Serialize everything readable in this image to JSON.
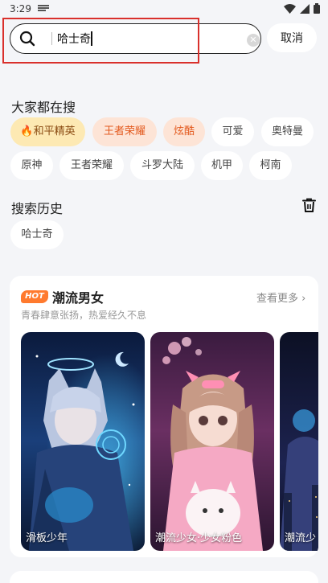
{
  "status_bar": {
    "time": "3:29"
  },
  "search": {
    "value": "哈士奇",
    "cancel_label": "取消"
  },
  "trending": {
    "title": "大家都在搜",
    "chips": [
      "🔥和平精英",
      "王者荣耀",
      "炫酷",
      "可爱",
      "奥特曼",
      "原神",
      "王者荣耀",
      "斗罗大陆",
      "机甲",
      "柯南"
    ]
  },
  "history": {
    "title": "搜索历史",
    "items": [
      "哈士奇"
    ]
  },
  "card": {
    "badge": "HOT",
    "title": "潮流男女",
    "more_label": "查看更多 ›",
    "subtitle": "青春肆意张扬，热爱经久不息",
    "thumbs": [
      {
        "label": "滑板少年"
      },
      {
        "label": "潮流少女·少女粉色"
      },
      {
        "label": "潮流少"
      }
    ]
  }
}
